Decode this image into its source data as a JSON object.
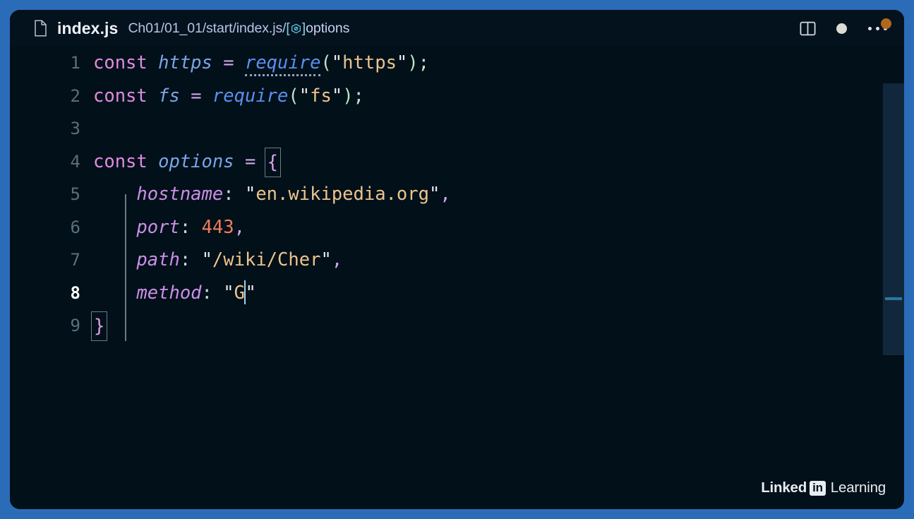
{
  "window": {
    "frame_color": "#2b6cb9",
    "editor_bg": "#021019",
    "titlebar_bg": "#04121d"
  },
  "titlebar": {
    "file_icon": "file-icon",
    "file_name": "index.js",
    "breadcrumb": {
      "path_text": "Ch01/01_01/start/index.js/",
      "symbol_open": "[",
      "symbol_icon": "object-cube-icon",
      "symbol_close": "]",
      "symbol_name": "options"
    },
    "actions": [
      {
        "name": "split-editor-button",
        "icon": "split-editor-icon",
        "label": "Split Editor"
      },
      {
        "name": "unsaved-indicator",
        "icon": "circle-filled-icon",
        "label": "Unsaved changes"
      },
      {
        "name": "more-actions-button",
        "icon": "ellipsis-icon",
        "label": "More Actions..."
      }
    ]
  },
  "editor": {
    "language": "javascript",
    "current_line": 8,
    "cursor": {
      "line": 8,
      "column": 14
    },
    "lines": [
      {
        "number": "1",
        "current": false
      },
      {
        "number": "2",
        "current": false
      },
      {
        "number": "3",
        "current": false
      },
      {
        "number": "4",
        "current": false
      },
      {
        "number": "5",
        "current": false
      },
      {
        "number": "6",
        "current": false
      },
      {
        "number": "7",
        "current": false
      },
      {
        "number": "8",
        "current": true
      },
      {
        "number": "9",
        "current": false
      }
    ],
    "code": {
      "l1": {
        "kw_const": "const",
        "var_https": "https",
        "op_eq": "=",
        "fn_require": "require",
        "paren_open": "(",
        "quote_open": "\"",
        "str_https": "https",
        "quote_close": "\"",
        "paren_close": ")",
        "semicolon": ";"
      },
      "l2": {
        "kw_const": "const",
        "var_fs": "fs",
        "op_eq": "=",
        "fn_require": "require",
        "paren_open": "(",
        "quote_open": "\"",
        "str_fs": "fs",
        "quote_close": "\"",
        "paren_close": ")",
        "semicolon": ";"
      },
      "l3": {
        "empty": ""
      },
      "l4": {
        "kw_const": "const",
        "var_options": "options",
        "op_eq": "=",
        "brace_open": "{"
      },
      "l5": {
        "indent": "    ",
        "prop": "hostname",
        "colon": ":",
        "space": " ",
        "quote_open": "\"",
        "value": "en.wikipedia.org",
        "quote_close": "\"",
        "comma": ","
      },
      "l6": {
        "indent": "    ",
        "prop": "port",
        "colon": ":",
        "space": " ",
        "value": "443",
        "comma": ","
      },
      "l7": {
        "indent": "    ",
        "prop": "path",
        "colon": ":",
        "space": " ",
        "quote_open": "\"",
        "value": "/wiki/Cher",
        "quote_close": "\"",
        "comma": ","
      },
      "l8": {
        "indent": "    ",
        "prop": "method",
        "colon": ":",
        "space": " ",
        "quote_open": "\"",
        "value": "G",
        "quote_close": "\""
      },
      "l9": {
        "brace_close": "}"
      }
    }
  },
  "scrollbar": {
    "name": "editor-scrollbar",
    "slider_color": "rgba(80,140,200,.20)",
    "mark_color": "#2f7fa8"
  },
  "watermark": {
    "linked": "Linked",
    "in": "in",
    "learning": "Learning"
  }
}
